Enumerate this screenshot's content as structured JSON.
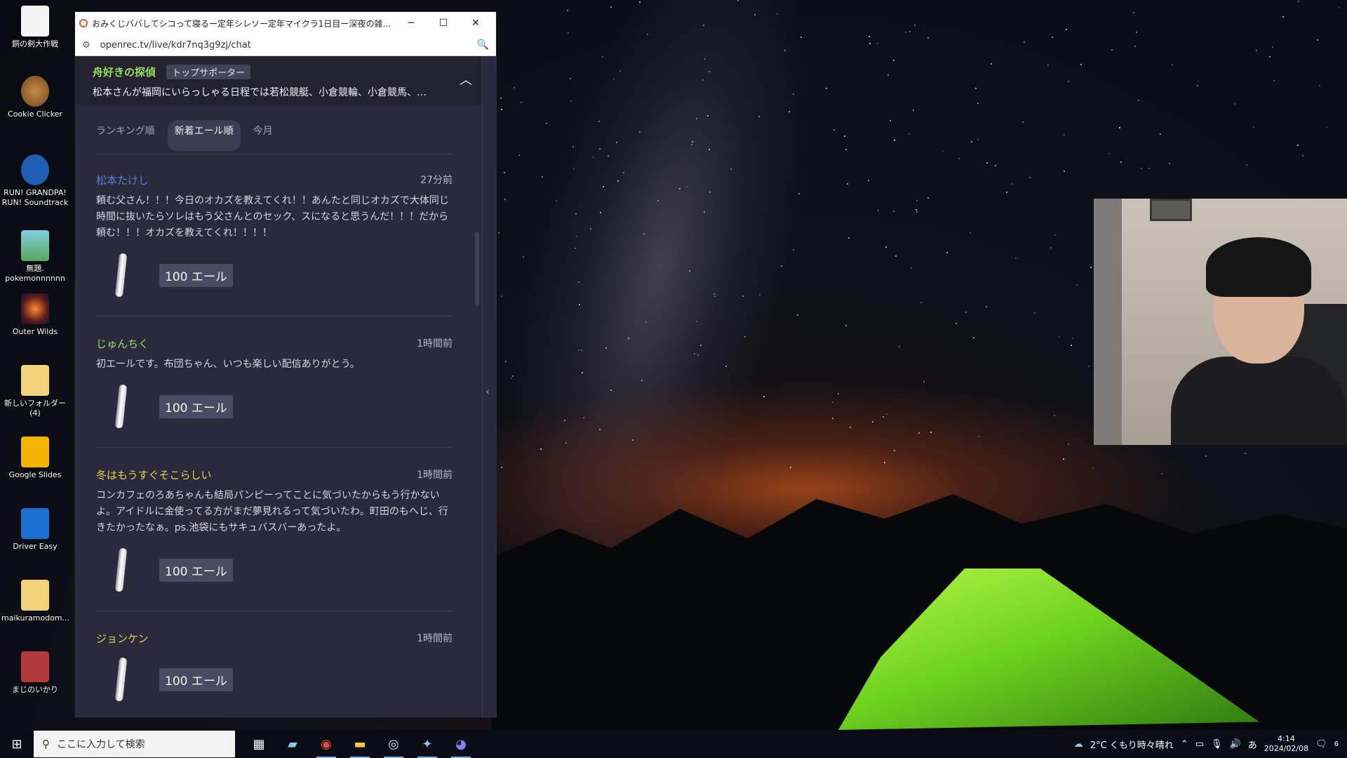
{
  "desktop": {
    "icons": [
      {
        "label": "銅の剣大作戦",
        "icon": "document-icon"
      },
      {
        "label": "Cookie Clicker",
        "icon": "cookie-icon"
      },
      {
        "label": "RUN! GRANDPA! RUN! Soundtrack",
        "icon": "music-note-icon"
      },
      {
        "label": "無題. pokemonnnnnn",
        "icon": "image-icon"
      },
      {
        "label": "Outer Wilds",
        "icon": "game-icon"
      },
      {
        "label": "新しいフォルダー (4)",
        "icon": "folder-icon"
      },
      {
        "label": "Google Slides",
        "icon": "slides-icon"
      },
      {
        "label": "Driver Easy",
        "icon": "driver-easy-icon"
      },
      {
        "label": "maikuramodom...",
        "icon": "folder-icon"
      },
      {
        "label": "まじのいかり",
        "icon": "book-icon"
      }
    ]
  },
  "browser": {
    "title": "おみくじババしてシコって寝るー定年シレソー定年マイクラ1日目ー深夜の雑談 | OPENREC...",
    "url": "openrec.tv/live/kdr7nq3g9zj/chat",
    "controls": {
      "minimize": "─",
      "maximize": "☐",
      "close": "✕"
    }
  },
  "pinned": {
    "name": "舟好きの探偵",
    "badge": "トップサポーター",
    "text": "松本さんが福岡にいらっしゃる日程では若松競艇、小倉競輪、小倉競馬、…"
  },
  "tabs": [
    {
      "label": "ランキング順",
      "active": false
    },
    {
      "label": "新着エール順",
      "active": true
    },
    {
      "label": "今月",
      "active": false
    }
  ],
  "messages": [
    {
      "name": "松本たけし",
      "name_color": "#5b7bd6",
      "time": "27分前",
      "body": "頼む父さん！！！今日のオカズを教えてくれ！！あんたと同じオカズで大体同じ時間に抜いたらソレはもう父さんとのセック、スになると思うんだ！！！だから頼む！！！オカズを教えてくれ！！！！",
      "yell": "100 エール"
    },
    {
      "name": "じゅんちく",
      "name_color": "#9be05a",
      "time": "1時間前",
      "body": "初エールです。布団ちゃん、いつも楽しい配信ありがとう。",
      "yell": "100 エール"
    },
    {
      "name": "冬はもうすぐそこらしい",
      "name_color": "#e8d24a",
      "time": "1時間前",
      "body": "コンカフェのろあちゃんも結局パンピーってことに気づいたからもう行かないよ。アイドルに金使ってる方がまだ夢見れるって気づいたわ。町田のもへじ、行きたかったなぁ。ps.池袋にもサキュバスバーあったよ。",
      "yell": "100 エール"
    },
    {
      "name": "ジョンケン",
      "name_color": "#e8d24a",
      "time": "1時間前",
      "body": "",
      "yell": "100 エール"
    }
  ],
  "taskbar": {
    "search_placeholder": "ここに入力して検索",
    "weather": "2°C くもり時々晴れ",
    "time": "4:14",
    "date": "2024/02/08",
    "ime": "あ",
    "notifications": "6"
  }
}
